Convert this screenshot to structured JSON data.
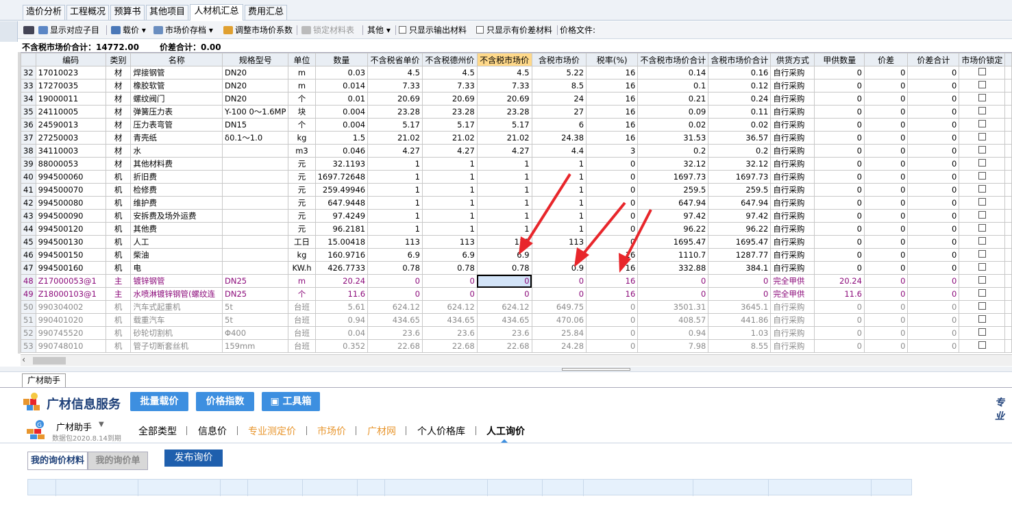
{
  "tabs": [
    "造价分析",
    "工程概况",
    "预算书",
    "其他项目",
    "人材机汇总",
    "费用汇总"
  ],
  "toolbar": {
    "show_sub": "显示对应子目",
    "load_price": "载价",
    "market_archive": "市场价存档",
    "adjust_coef": "调整市场价系数",
    "lock_table": "锁定材料表",
    "other": "其他",
    "only_output": "只显示输出材料",
    "only_diff": "只显示有价差材料",
    "price_file": "价格文件:"
  },
  "summary": {
    "market_total_label": "不含税市场价合计：14772.00",
    "diff_total_label": "价差合计：0.00"
  },
  "columns": [
    "编码",
    "类别",
    "名称",
    "规格型号",
    "单位",
    "数量",
    "不含税省单价",
    "不含税德州价",
    "不含税市场价",
    "含税市场价",
    "税率(%)",
    "不含税市场价合计",
    "含税市场价合计",
    "供货方式",
    "甲供数量",
    "价差",
    "价差合计",
    "市场价锁定"
  ],
  "rows": [
    {
      "n": "32",
      "code": "17010023",
      "cat": "材",
      "name": "焊接钢管",
      "spec": "DN20",
      "unit": "m",
      "qty": "0.03",
      "p1": "4.5",
      "p2": "4.5",
      "p3": "4.5",
      "p4": "5.22",
      "tax": "16",
      "t1": "0.14",
      "t2": "0.16",
      "supply": "自行采购",
      "jg": "0",
      "diff": "0",
      "dsum": "0",
      "style": ""
    },
    {
      "n": "33",
      "code": "17270035",
      "cat": "材",
      "name": "橡胶软管",
      "spec": "DN20",
      "unit": "m",
      "qty": "0.014",
      "p1": "7.33",
      "p2": "7.33",
      "p3": "7.33",
      "p4": "8.5",
      "tax": "16",
      "t1": "0.1",
      "t2": "0.12",
      "supply": "自行采购",
      "jg": "0",
      "diff": "0",
      "dsum": "0",
      "style": ""
    },
    {
      "n": "34",
      "code": "19000011",
      "cat": "材",
      "name": "螺纹阀门",
      "spec": "DN20",
      "unit": "个",
      "qty": "0.01",
      "p1": "20.69",
      "p2": "20.69",
      "p3": "20.69",
      "p4": "24",
      "tax": "16",
      "t1": "0.21",
      "t2": "0.24",
      "supply": "自行采购",
      "jg": "0",
      "diff": "0",
      "dsum": "0",
      "style": ""
    },
    {
      "n": "35",
      "code": "24110005",
      "cat": "材",
      "name": "弹簧压力表",
      "spec": "Y-100 0～1.6MP",
      "unit": "块",
      "qty": "0.004",
      "p1": "23.28",
      "p2": "23.28",
      "p3": "23.28",
      "p4": "27",
      "tax": "16",
      "t1": "0.09",
      "t2": "0.11",
      "supply": "自行采购",
      "jg": "0",
      "diff": "0",
      "dsum": "0",
      "style": ""
    },
    {
      "n": "36",
      "code": "24590013",
      "cat": "材",
      "name": "压力表弯管",
      "spec": "DN15",
      "unit": "个",
      "qty": "0.004",
      "p1": "5.17",
      "p2": "5.17",
      "p3": "5.17",
      "p4": "6",
      "tax": "16",
      "t1": "0.02",
      "t2": "0.02",
      "supply": "自行采购",
      "jg": "0",
      "diff": "0",
      "dsum": "0",
      "style": ""
    },
    {
      "n": "37",
      "code": "27250003",
      "cat": "材",
      "name": "青壳纸",
      "spec": "δ0.1～1.0",
      "unit": "kg",
      "qty": "1.5",
      "p1": "21.02",
      "p2": "21.02",
      "p3": "21.02",
      "p4": "24.38",
      "tax": "16",
      "t1": "31.53",
      "t2": "36.57",
      "supply": "自行采购",
      "jg": "0",
      "diff": "0",
      "dsum": "0",
      "style": ""
    },
    {
      "n": "38",
      "code": "34110003",
      "cat": "材",
      "name": "水",
      "spec": "",
      "unit": "m3",
      "qty": "0.046",
      "p1": "4.27",
      "p2": "4.27",
      "p3": "4.27",
      "p4": "4.4",
      "tax": "3",
      "t1": "0.2",
      "t2": "0.2",
      "supply": "自行采购",
      "jg": "0",
      "diff": "0",
      "dsum": "0",
      "style": ""
    },
    {
      "n": "39",
      "code": "88000053",
      "cat": "材",
      "name": "其他材料费",
      "spec": "",
      "unit": "元",
      "qty": "32.1193",
      "p1": "1",
      "p2": "1",
      "p3": "1",
      "p4": "1",
      "tax": "0",
      "t1": "32.12",
      "t2": "32.12",
      "supply": "自行采购",
      "jg": "0",
      "diff": "0",
      "dsum": "0",
      "style": ""
    },
    {
      "n": "40",
      "code": "994500060",
      "cat": "机",
      "name": "折旧费",
      "spec": "",
      "unit": "元",
      "qty": "1697.72648",
      "p1": "1",
      "p2": "1",
      "p3": "1",
      "p4": "1",
      "tax": "0",
      "t1": "1697.73",
      "t2": "1697.73",
      "supply": "自行采购",
      "jg": "0",
      "diff": "0",
      "dsum": "0",
      "style": ""
    },
    {
      "n": "41",
      "code": "994500070",
      "cat": "机",
      "name": "检修费",
      "spec": "",
      "unit": "元",
      "qty": "259.49946",
      "p1": "1",
      "p2": "1",
      "p3": "1",
      "p4": "1",
      "tax": "0",
      "t1": "259.5",
      "t2": "259.5",
      "supply": "自行采购",
      "jg": "0",
      "diff": "0",
      "dsum": "0",
      "style": ""
    },
    {
      "n": "42",
      "code": "994500080",
      "cat": "机",
      "name": "维护费",
      "spec": "",
      "unit": "元",
      "qty": "647.9448",
      "p1": "1",
      "p2": "1",
      "p3": "1",
      "p4": "1",
      "tax": "0",
      "t1": "647.94",
      "t2": "647.94",
      "supply": "自行采购",
      "jg": "0",
      "diff": "0",
      "dsum": "0",
      "style": ""
    },
    {
      "n": "43",
      "code": "994500090",
      "cat": "机",
      "name": "安拆费及场外运费",
      "spec": "",
      "unit": "元",
      "qty": "97.4249",
      "p1": "1",
      "p2": "1",
      "p3": "1",
      "p4": "1",
      "tax": "0",
      "t1": "97.42",
      "t2": "97.42",
      "supply": "自行采购",
      "jg": "0",
      "diff": "0",
      "dsum": "0",
      "style": ""
    },
    {
      "n": "44",
      "code": "994500120",
      "cat": "机",
      "name": "其他费",
      "spec": "",
      "unit": "元",
      "qty": "96.2181",
      "p1": "1",
      "p2": "1",
      "p3": "1",
      "p4": "1",
      "tax": "0",
      "t1": "96.22",
      "t2": "96.22",
      "supply": "自行采购",
      "jg": "0",
      "diff": "0",
      "dsum": "0",
      "style": ""
    },
    {
      "n": "45",
      "code": "994500130",
      "cat": "机",
      "name": "人工",
      "spec": "",
      "unit": "工日",
      "qty": "15.00418",
      "p1": "113",
      "p2": "113",
      "p3": "113",
      "p4": "113",
      "tax": "0",
      "t1": "1695.47",
      "t2": "1695.47",
      "supply": "自行采购",
      "jg": "0",
      "diff": "0",
      "dsum": "0",
      "style": ""
    },
    {
      "n": "46",
      "code": "994500150",
      "cat": "机",
      "name": "柴油",
      "spec": "",
      "unit": "kg",
      "qty": "160.9716",
      "p1": "6.9",
      "p2": "6.9",
      "p3": "6.9",
      "p4": "8",
      "tax": "16",
      "t1": "1110.7",
      "t2": "1287.77",
      "supply": "自行采购",
      "jg": "0",
      "diff": "0",
      "dsum": "0",
      "style": ""
    },
    {
      "n": "47",
      "code": "994500160",
      "cat": "机",
      "name": "电",
      "spec": "",
      "unit": "KW.h",
      "qty": "426.7733",
      "p1": "0.78",
      "p2": "0.78",
      "p3": "0.78",
      "p4": "0.9",
      "tax": "16",
      "t1": "332.88",
      "t2": "384.1",
      "supply": "自行采购",
      "jg": "0",
      "diff": "0",
      "dsum": "0",
      "style": ""
    },
    {
      "n": "48",
      "code": "Z17000053@1",
      "cat": "主",
      "name": "镀锌钢管",
      "spec": "DN25",
      "unit": "m",
      "qty": "20.24",
      "p1": "0",
      "p2": "0",
      "p3": "0",
      "p4": "0",
      "tax": "16",
      "t1": "0",
      "t2": "0",
      "supply": "完全甲供",
      "jg": "20.24",
      "diff": "0",
      "dsum": "0",
      "style": "zhu"
    },
    {
      "n": "49",
      "code": "Z18000103@1",
      "cat": "主",
      "name": "水喷淋镀锌钢管(螺纹连",
      "spec": "DN25",
      "unit": "个",
      "qty": "11.6",
      "p1": "0",
      "p2": "0",
      "p3": "0",
      "p4": "0",
      "tax": "16",
      "t1": "0",
      "t2": "0",
      "supply": "完全甲供",
      "jg": "11.6",
      "diff": "0",
      "dsum": "0",
      "style": "zhu"
    },
    {
      "n": "50",
      "code": "990304002",
      "cat": "机",
      "name": "汽车式起重机",
      "spec": "5t",
      "unit": "台班",
      "qty": "5.61",
      "p1": "624.12",
      "p2": "624.12",
      "p3": "624.12",
      "p4": "649.75",
      "tax": "0",
      "t1": "3501.31",
      "t2": "3645.1",
      "supply": "自行采购",
      "jg": "0",
      "diff": "0",
      "dsum": "0",
      "style": "gray"
    },
    {
      "n": "51",
      "code": "990401020",
      "cat": "机",
      "name": "载重汽车",
      "spec": "5t",
      "unit": "台班",
      "qty": "0.94",
      "p1": "434.65",
      "p2": "434.65",
      "p3": "434.65",
      "p4": "470.06",
      "tax": "0",
      "t1": "408.57",
      "t2": "441.86",
      "supply": "自行采购",
      "jg": "0",
      "diff": "0",
      "dsum": "0",
      "style": "gray"
    },
    {
      "n": "52",
      "code": "990745520",
      "cat": "机",
      "name": "砂轮切割机",
      "spec": "Φ400",
      "unit": "台班",
      "qty": "0.04",
      "p1": "23.6",
      "p2": "23.6",
      "p3": "23.6",
      "p4": "25.84",
      "tax": "0",
      "t1": "0.94",
      "t2": "1.03",
      "supply": "自行采购",
      "jg": "0",
      "diff": "0",
      "dsum": "0",
      "style": "gray"
    },
    {
      "n": "53",
      "code": "990748010",
      "cat": "机",
      "name": "管子切断套丝机",
      "spec": "159mm",
      "unit": "台班",
      "qty": "0.352",
      "p1": "22.68",
      "p2": "22.68",
      "p3": "22.68",
      "p4": "24.28",
      "tax": "0",
      "t1": "7.98",
      "t2": "8.55",
      "supply": "自行采购",
      "jg": "0",
      "diff": "0",
      "dsum": "0",
      "style": "gray"
    }
  ],
  "bottom": {
    "panel_tab": "广材助手",
    "brand": "广材信息服务",
    "btn_batch": "批量载价",
    "btn_index": "价格指数",
    "btn_tools": "工具箱",
    "right_link": "专业",
    "assistant": "广材助手",
    "expire": "数据包2020.8.14到期",
    "nav": [
      "全部类型",
      "信息价",
      "专业测定价",
      "市场价",
      "广材网",
      "个人价格库",
      "人工询价"
    ],
    "sub_tab1": "我的询价材料",
    "sub_tab2": "我的询价单",
    "publish": "发布询价"
  },
  "colors": {
    "accent": "#3d8fe0",
    "brand": "#1d3f78",
    "highlight_header": "#ffd98a",
    "main_material": "#8b0a7a",
    "arrow": "#e8262b"
  }
}
